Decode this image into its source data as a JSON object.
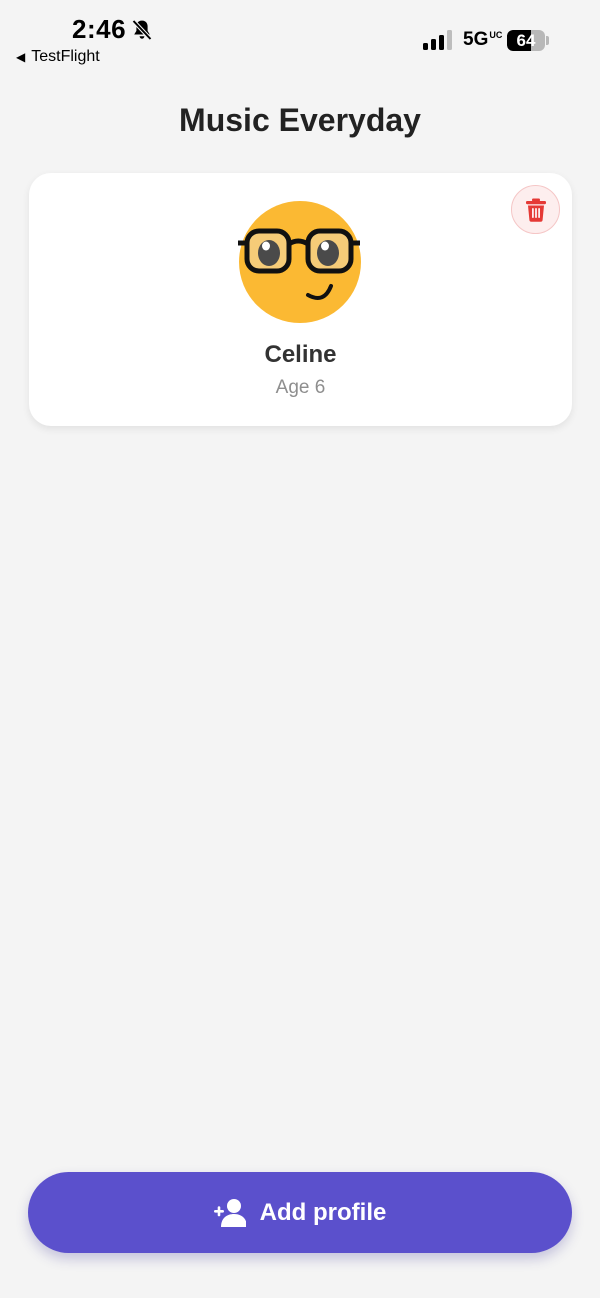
{
  "status_bar": {
    "time": "2:46",
    "back_label": "TestFlight",
    "network": "5G",
    "network_suffix": "UC",
    "battery_percent": 64,
    "battery_label": "64",
    "icons": [
      "bell-slash-icon",
      "signal-bars-icon",
      "battery-icon"
    ]
  },
  "page": {
    "title": "Music Everyday"
  },
  "profiles": [
    {
      "name": "Celine",
      "age_label": "Age 6",
      "avatar_icon": "nerd-face-icon",
      "delete_icon": "trash-icon"
    }
  ],
  "actions": {
    "add_profile_label": "Add profile",
    "add_profile_icon": "person-plus-icon"
  },
  "colors": {
    "background": "#f4f4f4",
    "accent": "#5b50cc",
    "avatar": "#fbb933",
    "delete": "#e53935",
    "age_text": "#8e8e8e"
  }
}
